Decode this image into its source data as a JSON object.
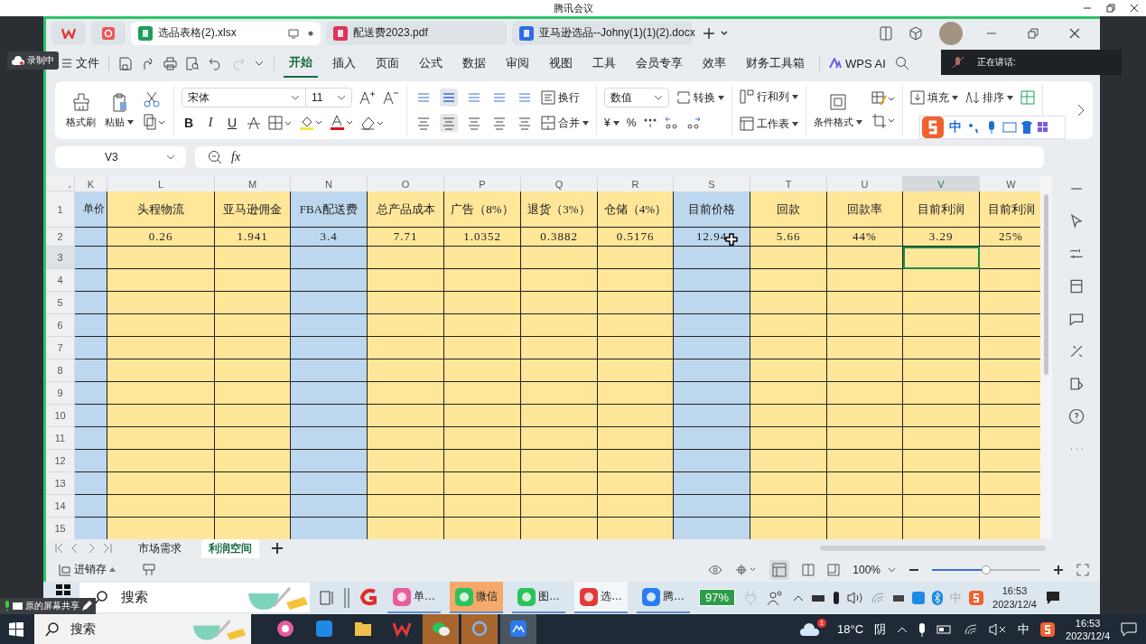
{
  "meeting": {
    "title": "腾讯会议"
  },
  "recording": {
    "label": "录制中"
  },
  "speaking": {
    "label": "正在讲话:"
  },
  "doc_tabs": [
    {
      "label": "选品表格(2).xlsx",
      "kind": "sheet",
      "selected": true
    },
    {
      "label": "配送费2023.pdf",
      "kind": "pdf",
      "selected": false
    },
    {
      "label": "亚马逊选品--Johny(1)(1)(2).docx",
      "kind": "doc",
      "selected": false
    }
  ],
  "file_menu": {
    "label": "文件"
  },
  "menu_tabs": [
    {
      "label": "开始",
      "selected": true
    },
    {
      "label": "插入",
      "selected": false
    },
    {
      "label": "页面",
      "selected": false
    },
    {
      "label": "公式",
      "selected": false
    },
    {
      "label": "数据",
      "selected": false
    },
    {
      "label": "审阅",
      "selected": false
    },
    {
      "label": "视图",
      "selected": false
    },
    {
      "label": "工具",
      "selected": false
    },
    {
      "label": "会员专享",
      "selected": false
    },
    {
      "label": "效率",
      "selected": false
    },
    {
      "label": "财务工具箱",
      "selected": false
    }
  ],
  "ai_menu": {
    "label": "WPS AI"
  },
  "ribbon": {
    "format_painter": "格式刷",
    "paste": "粘贴",
    "font": "宋体",
    "size": "11",
    "style_letters": [
      "B",
      "I",
      "U"
    ],
    "wrap": "换行",
    "merge": "合并",
    "number_format": "数值",
    "convert": "转换",
    "currency": "¥",
    "percent": "%",
    "rows_cols": "行和列",
    "worksheet": "工作表",
    "conditional": "条件格式",
    "fill": "填充",
    "sort": "排序"
  },
  "ime": {
    "mode": "中"
  },
  "formula_bar": {
    "cell": "V3",
    "fx": "fx"
  },
  "columns": [
    {
      "letter": "K",
      "header": "单价",
      "color": "#bdd7ee",
      "selected": false
    },
    {
      "letter": "L",
      "header": "头程物流",
      "value": "0.26",
      "color": "#ffe699",
      "selected": false
    },
    {
      "letter": "M",
      "header": "亚马逊佣金",
      "value": "1.941",
      "color": "#ffe699",
      "selected": false
    },
    {
      "letter": "N",
      "header": "FBA配送费",
      "value": "3.4",
      "color": "#bdd7ee",
      "selected": false
    },
    {
      "letter": "O",
      "header": "总产品成本",
      "value": "7.71",
      "color": "#ffe699",
      "selected": false
    },
    {
      "letter": "P",
      "header": "广告（8%）",
      "value": "1.0352",
      "color": "#ffe699",
      "selected": false
    },
    {
      "letter": "Q",
      "header": "退货（3%）",
      "value": "0.3882",
      "color": "#ffe699",
      "selected": false
    },
    {
      "letter": "R",
      "header": "仓储（4%）",
      "value": "0.5176",
      "color": "#ffe699",
      "selected": false
    },
    {
      "letter": "S",
      "header": "目前价格",
      "value": "12.94",
      "color": "#bdd7ee",
      "selected": false
    },
    {
      "letter": "T",
      "header": "回款",
      "value": "5.66",
      "color": "#ffe699",
      "selected": false
    },
    {
      "letter": "U",
      "header": "回款率",
      "value": "44%",
      "color": "#ffe699",
      "selected": false
    },
    {
      "letter": "V",
      "header": "目前利润",
      "value": "3.29",
      "color": "#ffe699",
      "selected": true
    },
    {
      "letter": "W",
      "header": "目前利润",
      "value": "25%",
      "color": "#ffe699",
      "selected": false
    }
  ],
  "rows": [
    {
      "number": "1",
      "selected": false
    },
    {
      "number": "2",
      "selected": false
    },
    {
      "number": "3",
      "selected": true
    },
    {
      "number": "4",
      "selected": false
    },
    {
      "number": "5",
      "selected": false
    },
    {
      "number": "6",
      "selected": false
    },
    {
      "number": "7",
      "selected": false
    },
    {
      "number": "8",
      "selected": false
    },
    {
      "number": "9",
      "selected": false
    },
    {
      "number": "10",
      "selected": false
    },
    {
      "number": "11",
      "selected": false
    },
    {
      "number": "12",
      "selected": false
    },
    {
      "number": "13",
      "selected": false
    },
    {
      "number": "14",
      "selected": false
    },
    {
      "number": "15",
      "selected": false
    }
  ],
  "sheets": [
    {
      "label": "市场需求",
      "selected": false
    },
    {
      "label": "利润空间",
      "selected": true
    }
  ],
  "status": {
    "mode": "进销存",
    "zoom": "100%",
    "zoom_slider": {
      "level": 0.5
    }
  },
  "remote_taskbar": {
    "search": {
      "placeholder": "搜索"
    },
    "apps": [
      {
        "label": "单…",
        "kind": "wheel",
        "flashing": false,
        "selected": false
      },
      {
        "label": "微信",
        "kind": "chat",
        "flashing": true,
        "selected": false
      },
      {
        "label": "图…",
        "kind": "chat",
        "flashing": false,
        "selected": false
      },
      {
        "label": "选…",
        "kind": "wps",
        "flashing": false,
        "selected": true
      },
      {
        "label": "腾…",
        "kind": "meeting",
        "flashing": false,
        "selected": false
      }
    ],
    "battery": "97%",
    "ime": "中",
    "time": "16:53",
    "date": "2023/12/4"
  },
  "share_badge": {
    "label": "原的屏幕共享"
  },
  "taskbar": {
    "search": {
      "placeholder": "搜索"
    },
    "weather": {
      "temp": "18°C",
      "sky": "阴",
      "badge": "1"
    },
    "ime": "中",
    "time": "16:53",
    "date": "2023/12/4"
  }
}
